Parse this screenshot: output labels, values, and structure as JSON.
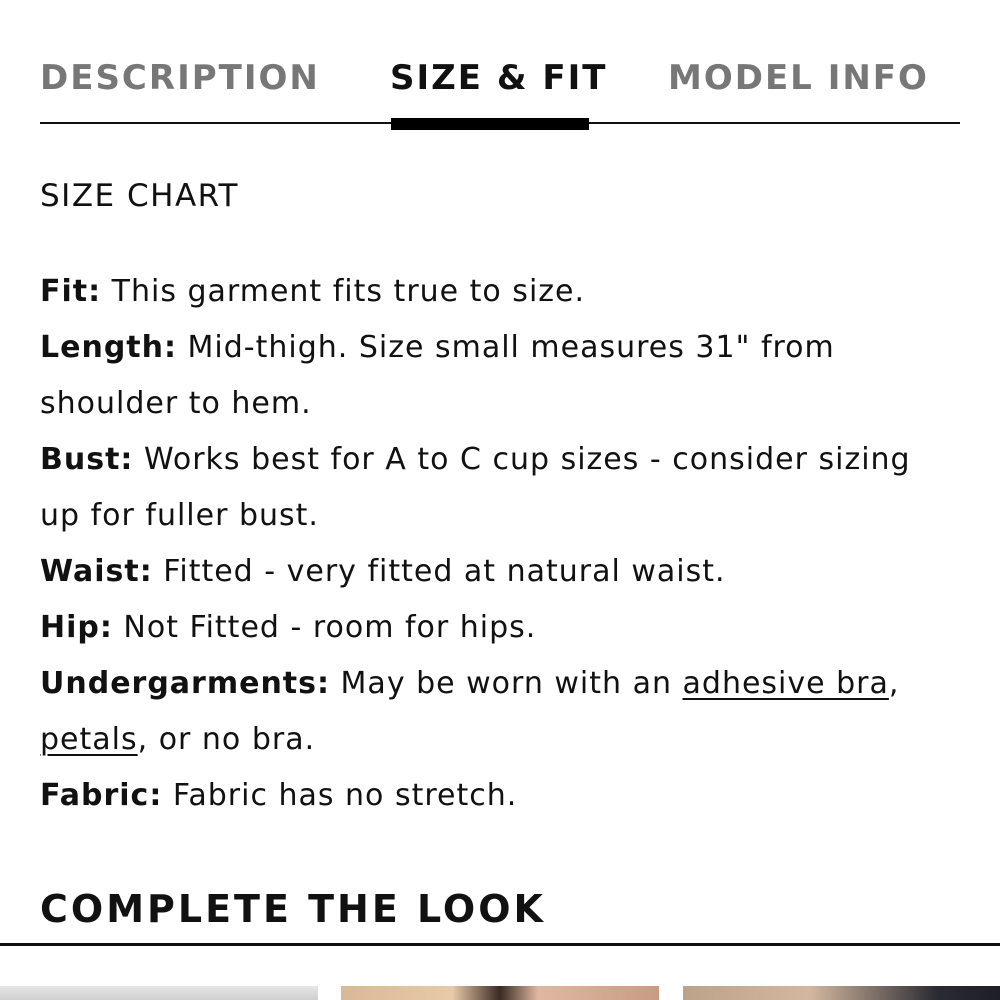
{
  "tabs": [
    {
      "label": "DESCRIPTION",
      "active": false
    },
    {
      "label": "SIZE & FIT",
      "active": true
    },
    {
      "label": "MODEL INFO",
      "active": false
    }
  ],
  "size_chart_label": "SIZE CHART",
  "fit_details": {
    "fit": {
      "label": "Fit:",
      "text": " This garment fits true to size."
    },
    "length": {
      "label": "Length:",
      "text": " Mid-thigh. Size small measures 31\" from shoulder to hem."
    },
    "bust": {
      "label": "Bust:",
      "text": " Works best for A to C cup sizes - consider sizing up for fuller bust."
    },
    "waist": {
      "label": "Waist:",
      "text": " Fitted - very fitted at natural waist."
    },
    "hip": {
      "label": "Hip:",
      "text": " Not Fitted - room for hips."
    },
    "undergarments": {
      "label": "Undergarments:",
      "text_before": " May be worn with an ",
      "link_adhesive_bra": "adhesive bra",
      "separator": ", ",
      "link_petals": "petals",
      "text_after": ", or no bra."
    },
    "fabric": {
      "label": "Fabric:",
      "text": " Fabric has no stretch."
    }
  },
  "complete_the_look": {
    "title": "COMPLETE THE LOOK"
  },
  "colors": {
    "active_tab": "#111111",
    "inactive_tab": "#777777",
    "text": "#111111"
  }
}
